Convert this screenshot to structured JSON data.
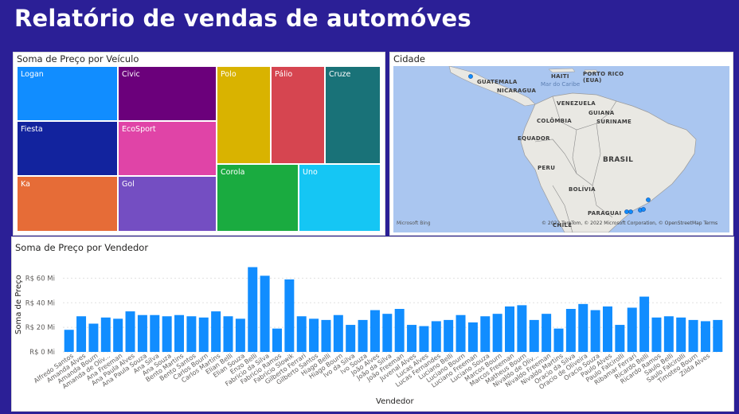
{
  "page": {
    "title": "Relatório de vendas de automóves"
  },
  "treemap": {
    "title": "Soma de Preço por Veículo",
    "tiles": [
      {
        "label": "Logan",
        "color": "#118dff"
      },
      {
        "label": "Fiesta",
        "color": "#12239e"
      },
      {
        "label": "Ka",
        "color": "#e66c37"
      },
      {
        "label": "Civic",
        "color": "#6b007b"
      },
      {
        "label": "EcoSport",
        "color": "#e044a7"
      },
      {
        "label": "Gol",
        "color": "#744ec2"
      },
      {
        "label": "Polo",
        "color": "#d9b300"
      },
      {
        "label": "Pálio",
        "color": "#d64550"
      },
      {
        "label": "Cruze",
        "color": "#197278"
      },
      {
        "label": "Corola",
        "color": "#1aab40"
      },
      {
        "label": "Uno",
        "color": "#15c6f4"
      }
    ]
  },
  "map": {
    "title": "Cidade",
    "countries": [
      "HAITI",
      "PORTO RICO (EUA)",
      "GUATEMALA",
      "NICARAGUA",
      "VENEZUELA",
      "GUIANA",
      "COLÔMBIA",
      "SURINAME",
      "EQUADOR",
      "PERU",
      "BRASIL",
      "BOLÍVIA",
      "PARAGUAI",
      "CHILE"
    ],
    "sea": "Mar do Caribe",
    "attribution": "© 2022 TomTom, © 2022 Microsoft Corporation, © OpenStreetMap  Terms",
    "provider": "Microsoft Bing",
    "point_color": "#118dff"
  },
  "chart_data": {
    "type": "bar",
    "title": "Soma de Preço por Vendedor",
    "xlabel": "Vendedor",
    "ylabel": "Soma de Preço",
    "ylim": [
      0,
      70
    ],
    "yticks": [
      "R$ 0 Mi",
      "R$ 20 Mi",
      "R$ 40 Mi",
      "R$ 60 Mi"
    ],
    "ytick_values": [
      0,
      20,
      40,
      60
    ],
    "bar_color": "#118dff",
    "categories": [
      "Alfredo Santos",
      "Amanda Alves",
      "Amanda Bourn",
      "Amanda de Oliv...",
      "Ana Freeman",
      "Ana Paula Alves",
      "Ana Paula Souza",
      "Ana Silva",
      "Ana Souza",
      "Bento Martins",
      "Bento Santos",
      "Carlos Bourn",
      "Carlos Martins",
      "Elian Belli",
      "Elian Souza",
      "Enzo Belli",
      "Fabricio da Silva",
      "Fabricio Ramos",
      "Fabricio Slowik",
      "Gilberto Ferrari",
      "Gilberto Santos",
      "Hiago Belli",
      "Hiago Bourn",
      "Ivo da Silva",
      "Ivo Souza",
      "João Alves",
      "João da Silva",
      "João Freeman",
      "Juvenal Alves",
      "Lucas Alves",
      "Lucas Fernandes",
      "Luciano Belli",
      "Luciano Bourn",
      "Luciano Freeman",
      "Luciano Souza",
      "Marcos Bourn",
      "Marcos Freeman",
      "Matheus Bourn",
      "Nivaldo de Oliv...",
      "Nivaldo Freeman",
      "Nivaldo Martins",
      "Oracio da Silva",
      "Oracio de Oliveira",
      "Oracio Souza",
      "Paulo Alves",
      "Paulo Falcirolli",
      "Ribamar Ferrari",
      "Ricardo Belli",
      "Ricardo Ramos",
      "Saulo Belli",
      "Saulo Falcirolli",
      "Timoteo Bourn",
      "Zilda Alves"
    ],
    "values": [
      18,
      29,
      23,
      28,
      27,
      33,
      30,
      30,
      29,
      30,
      29,
      28,
      33,
      29,
      27,
      69,
      62,
      19,
      59,
      29,
      27,
      26,
      30,
      22,
      26,
      34,
      31,
      35,
      22,
      21,
      25,
      26,
      30,
      24,
      29,
      31,
      37,
      38,
      26,
      31,
      19,
      35,
      39,
      34,
      37,
      22,
      36,
      45,
      28,
      29,
      28,
      26,
      25,
      26
    ]
  }
}
